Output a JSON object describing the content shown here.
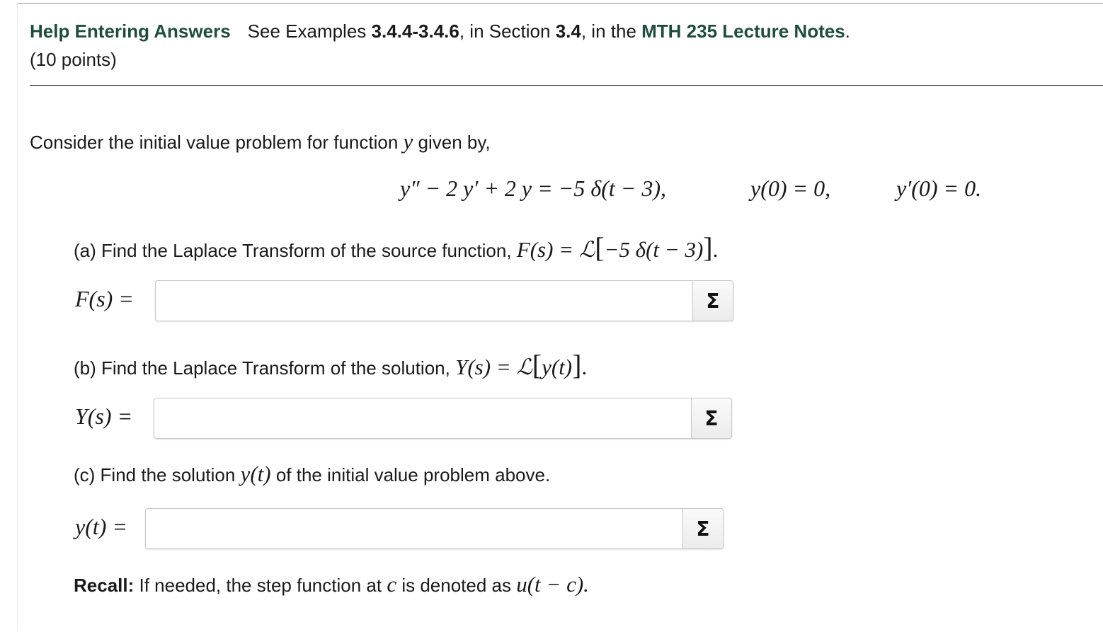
{
  "header": {
    "help_link": "Help Entering Answers",
    "see_examples": "See Examples ",
    "examples_range": "3.4.4-3.4.6",
    "in_section": ", in Section ",
    "section": "3.4",
    "in_the": ", in the ",
    "notes_link": "MTH 235 Lecture Notes",
    "period": ".",
    "points": "(10 points)"
  },
  "problem": {
    "intro": "Consider the initial value problem for function",
    "intro_var": "y",
    "intro_end": "given by,",
    "equation": "y″ − 2 y′ + 2 y = −5 δ(t − 3),",
    "ic1": "y(0) = 0,",
    "ic2": "y′(0) = 0."
  },
  "part_a": {
    "prompt": "(a) Find the Laplace Transform of the source function,",
    "math_lhs": "F(s) = ℒ",
    "math_inner": "−5 δ(t − 3)",
    "label": "F(s) =",
    "value": ""
  },
  "part_b": {
    "prompt": "(b) Find the Laplace Transform of the solution,",
    "math_lhs": "Y(s) = ℒ",
    "math_inner": "y(t)",
    "label": "Y(s) =",
    "value": ""
  },
  "part_c": {
    "prompt_start": "(c) Find the solution",
    "prompt_math": "y(t)",
    "prompt_end": "of the initial value problem above.",
    "label": "y(t) =",
    "value": ""
  },
  "recall": {
    "bold": "Recall:",
    "text": "If needed, the step function at",
    "var": "c",
    "text2": "is denoted as",
    "expr": "u(t − c)."
  },
  "sigma_label": "Σ",
  "colors": {
    "link_green": "#1e4d40"
  }
}
